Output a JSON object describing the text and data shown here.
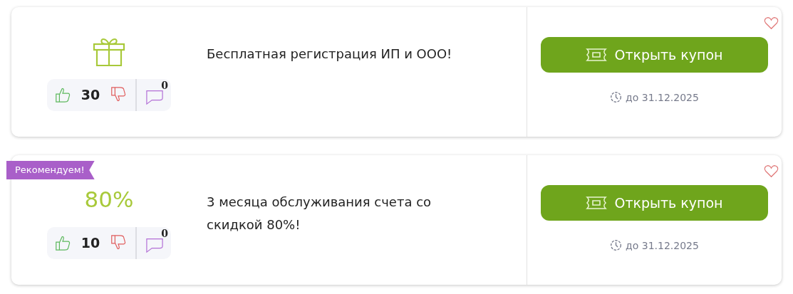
{
  "coupons": [
    {
      "visual": {
        "kind": "gift"
      },
      "title": "Бесплатная регистрация ИП и ООО!",
      "likes": "30",
      "comments": "0",
      "button": "Открыть купон",
      "expires": "до 31.12.2025"
    },
    {
      "badge": "Рекомендуем!",
      "visual": {
        "kind": "discount",
        "text": "80%"
      },
      "title": "3 месяца обслуживания счета со скидкой 80%!",
      "likes": "10",
      "comments": "0",
      "button": "Открыть купон",
      "expires": "до 31.12.2025"
    }
  ]
}
